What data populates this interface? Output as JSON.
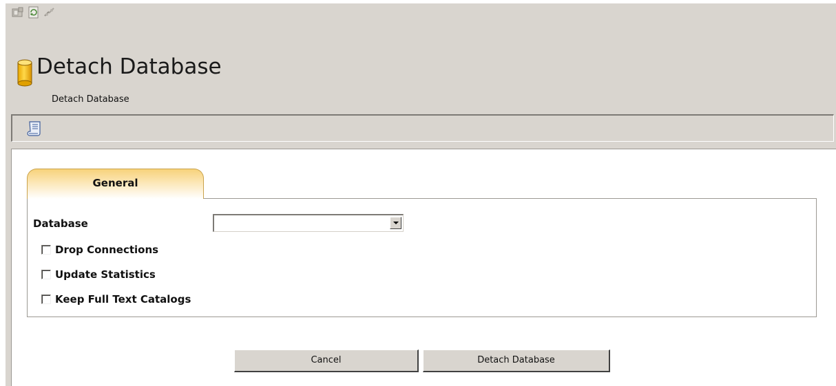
{
  "toolbar": {
    "icons": [
      "new-query-icon",
      "refresh-icon",
      "connect-icon"
    ]
  },
  "header": {
    "title": "Detach Database",
    "subtitle": "Detach Database",
    "icon": "database-icon"
  },
  "script_strip": {
    "icon": "script-icon"
  },
  "tabs": [
    {
      "label": "General",
      "active": true
    }
  ],
  "form": {
    "database_label": "Database",
    "database_value": "",
    "options": [
      {
        "label": "Drop Connections",
        "checked": false
      },
      {
        "label": "Update Statistics",
        "checked": false
      },
      {
        "label": "Keep Full Text Catalogs",
        "checked": false
      }
    ]
  },
  "buttons": {
    "cancel": "Cancel",
    "detach": "Detach Database"
  },
  "colors": {
    "window_background": "#d9d5cf",
    "tab_accent": "#f7d27b",
    "panel_background": "#ffffff"
  }
}
